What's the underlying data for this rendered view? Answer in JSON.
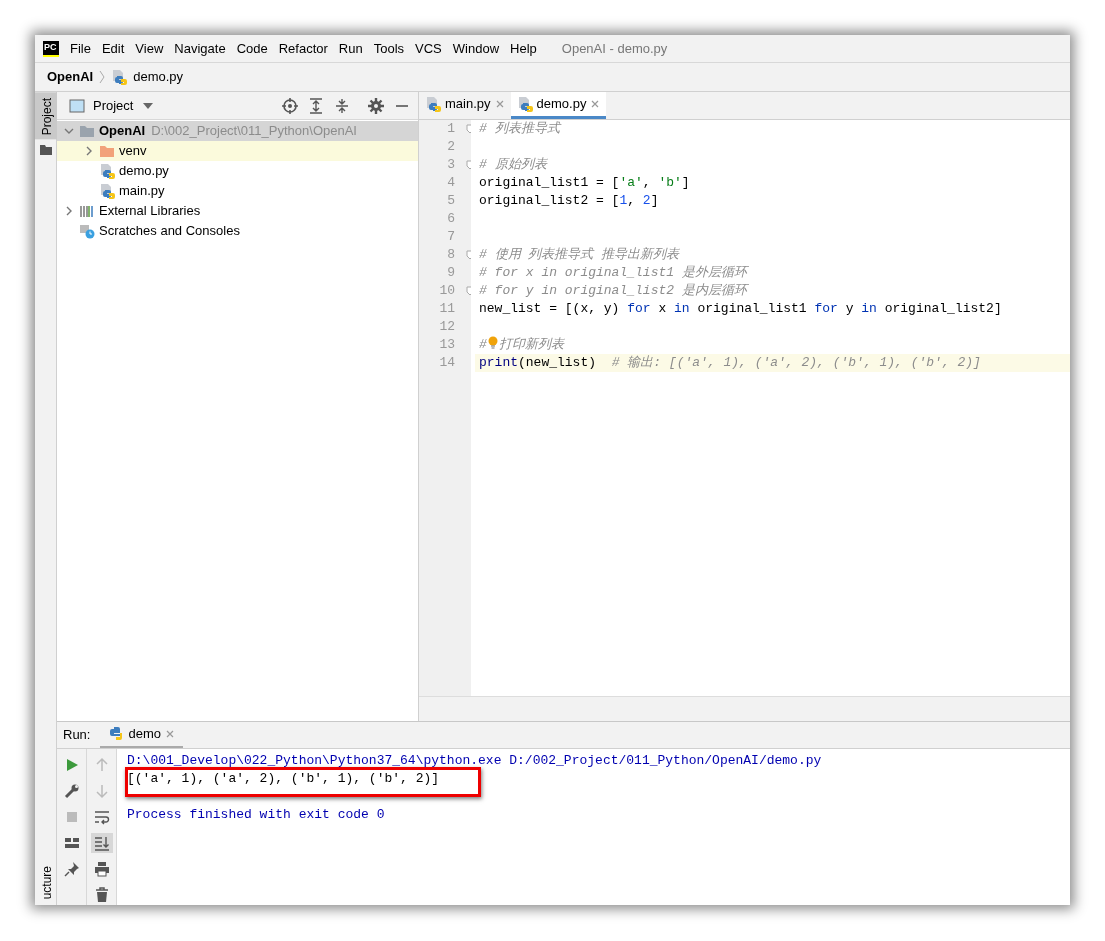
{
  "window": {
    "logo": "PC",
    "title": "OpenAI - demo.py"
  },
  "menu": [
    "File",
    "Edit",
    "View",
    "Navigate",
    "Code",
    "Refactor",
    "Run",
    "Tools",
    "VCS",
    "Window",
    "Help"
  ],
  "breadcrumb": [
    {
      "label": "OpenAI",
      "kind": "project"
    },
    {
      "label": "demo.py",
      "kind": "file"
    }
  ],
  "tool_strip": [
    {
      "label": "Project",
      "selected": true,
      "kind": "top"
    },
    {
      "label": "ucture",
      "selected": false,
      "kind": "bottom"
    }
  ],
  "project_panel": {
    "title": "Project",
    "tree": [
      {
        "label": "OpenAI",
        "path": "D:\\002_Project\\011_Python\\OpenAI",
        "kind": "folder",
        "expanded": true,
        "selected": true,
        "excluded": false,
        "children": [
          {
            "label": "venv",
            "kind": "excluded-folder",
            "expanded": false,
            "selected": false,
            "excluded": true
          },
          {
            "label": "demo.py",
            "kind": "python",
            "selected": false,
            "excluded": false
          },
          {
            "label": "main.py",
            "kind": "python",
            "selected": false,
            "excluded": false
          }
        ]
      },
      {
        "label": "External Libraries",
        "kind": "libraries",
        "expanded": false,
        "selected": false,
        "excluded": false
      },
      {
        "label": "Scratches and Consoles",
        "kind": "scratches",
        "selected": false,
        "excluded": false
      }
    ]
  },
  "editor": {
    "tabs": [
      {
        "label": "main.py",
        "selected": false
      },
      {
        "label": "demo.py",
        "selected": true
      }
    ],
    "lines": [
      {
        "number": "1",
        "fold": true,
        "current": false,
        "tokens": [
          {
            "kind": "comment",
            "text": "# 列表推导式"
          }
        ]
      },
      {
        "number": "2",
        "fold": false,
        "current": false
      },
      {
        "number": "3",
        "fold": true,
        "current": false,
        "tokens": [
          {
            "kind": "comment",
            "text": "# 原始列表"
          }
        ]
      },
      {
        "number": "4",
        "fold": false,
        "current": false,
        "tokens": [
          {
            "kind": "plain",
            "text": "original_list1 = ["
          },
          {
            "kind": "string",
            "text": "'a'"
          },
          {
            "kind": "plain",
            "text": ", "
          },
          {
            "kind": "string",
            "text": "'b'"
          },
          {
            "kind": "plain",
            "text": "]"
          }
        ]
      },
      {
        "number": "5",
        "fold": false,
        "current": false,
        "tokens": [
          {
            "kind": "plain",
            "text": "original_list2 = ["
          },
          {
            "kind": "number",
            "text": "1"
          },
          {
            "kind": "plain",
            "text": ", "
          },
          {
            "kind": "number",
            "text": "2"
          },
          {
            "kind": "plain",
            "text": "]"
          }
        ]
      },
      {
        "number": "6",
        "fold": false,
        "current": false
      },
      {
        "number": "7",
        "fold": false,
        "current": false
      },
      {
        "number": "8",
        "fold": true,
        "current": false,
        "tokens": [
          {
            "kind": "comment",
            "text": "# 使用 列表推导式 推导出新列表"
          }
        ]
      },
      {
        "number": "9",
        "fold": false,
        "current": false,
        "tokens": [
          {
            "kind": "comment",
            "text": "# for x in original_list1 是外层循环"
          }
        ]
      },
      {
        "number": "10",
        "fold": true,
        "current": false,
        "tokens": [
          {
            "kind": "comment",
            "text": "# for y in original_list2 是内层循环"
          }
        ]
      },
      {
        "number": "11",
        "fold": false,
        "current": false,
        "tokens": [
          {
            "kind": "plain",
            "text": "new_list = [(x, y) "
          },
          {
            "kind": "keyword",
            "text": "for"
          },
          {
            "kind": "plain",
            "text": " x "
          },
          {
            "kind": "keyword",
            "text": "in"
          },
          {
            "kind": "plain",
            "text": " original_list1 "
          },
          {
            "kind": "keyword",
            "text": "for"
          },
          {
            "kind": "plain",
            "text": " y "
          },
          {
            "kind": "keyword",
            "text": "in"
          },
          {
            "kind": "plain",
            "text": " original_list2]"
          }
        ]
      },
      {
        "number": "12",
        "fold": false,
        "current": false
      },
      {
        "number": "13",
        "fold": false,
        "current": false,
        "tokens": [
          {
            "kind": "comment",
            "text": "#"
          },
          {
            "kind": "bulb"
          },
          {
            "kind": "comment",
            "text": "打印新列表"
          }
        ]
      },
      {
        "number": "14",
        "fold": false,
        "current": true,
        "tokens": [
          {
            "kind": "builtin",
            "text": "print"
          },
          {
            "kind": "plain",
            "text": "(new_list)  "
          },
          {
            "kind": "comment",
            "text": "# 输出: [('a', 1), ('a', 2), ('b', 1), ('b', 2)]"
          }
        ]
      }
    ]
  },
  "run_panel": {
    "label": "Run:",
    "tabs": [
      {
        "label": "demo",
        "selected": true
      }
    ],
    "console": [
      {
        "kind": "command",
        "text": "D:\\001_Develop\\022_Python\\Python37_64\\python.exe D:/002_Project/011_Python/OpenAI/demo.py",
        "boxed": false
      },
      {
        "kind": "output",
        "text": "[('a', 1), ('a', 2), ('b', 1), ('b', 2)]",
        "boxed": true
      },
      {
        "kind": "blank",
        "boxed": false
      },
      {
        "kind": "info",
        "text": "Process finished with exit code 0",
        "boxed": false
      }
    ]
  }
}
